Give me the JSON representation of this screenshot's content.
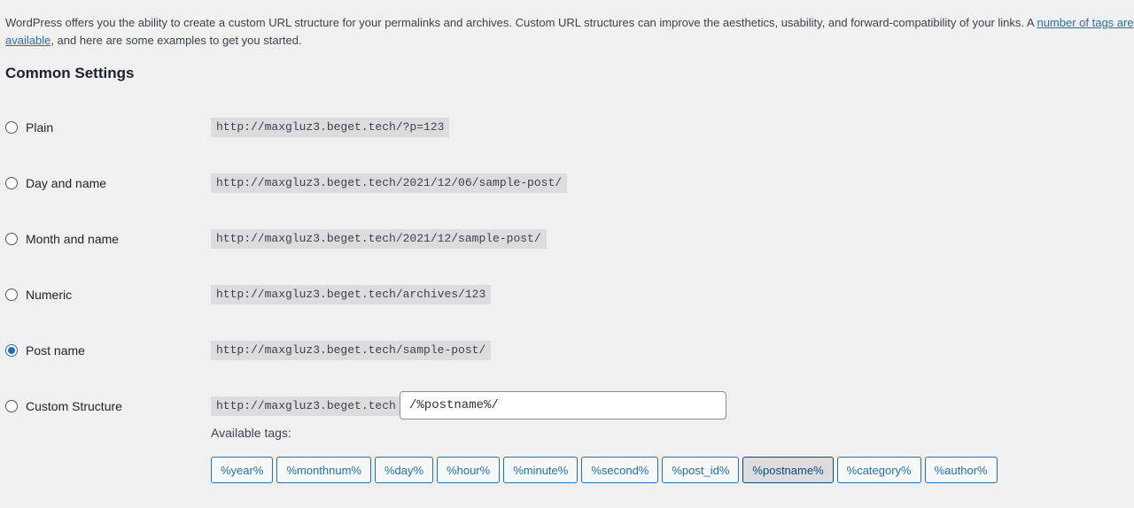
{
  "intro": {
    "text": "WordPress offers you the ability to create a custom URL structure for your permalinks and archives. Custom URL structures can improve the aesthetics, usability, and forward-compatibility of your links. A ",
    "link_text": "number of tags are available",
    "text_after": ", and here are some examples to get you started."
  },
  "section_title": "Common Settings",
  "options": [
    {
      "label": "Plain",
      "example": "http://maxgluz3.beget.tech/?p=123",
      "checked": false
    },
    {
      "label": "Day and name",
      "example": "http://maxgluz3.beget.tech/2021/12/06/sample-post/",
      "checked": false
    },
    {
      "label": "Month and name",
      "example": "http://maxgluz3.beget.tech/2021/12/sample-post/",
      "checked": false
    },
    {
      "label": "Numeric",
      "example": "http://maxgluz3.beget.tech/archives/123",
      "checked": false
    },
    {
      "label": "Post name",
      "example": "http://maxgluz3.beget.tech/sample-post/",
      "checked": true
    }
  ],
  "custom": {
    "label": "Custom Structure",
    "base_url": "http://maxgluz3.beget.tech",
    "value": "/%postname%/",
    "checked": false
  },
  "available_tags_label": "Available tags:",
  "tags": [
    {
      "label": "%year%",
      "active": false
    },
    {
      "label": "%monthnum%",
      "active": false
    },
    {
      "label": "%day%",
      "active": false
    },
    {
      "label": "%hour%",
      "active": false
    },
    {
      "label": "%minute%",
      "active": false
    },
    {
      "label": "%second%",
      "active": false
    },
    {
      "label": "%post_id%",
      "active": false
    },
    {
      "label": "%postname%",
      "active": true
    },
    {
      "label": "%category%",
      "active": false
    },
    {
      "label": "%author%",
      "active": false
    }
  ]
}
